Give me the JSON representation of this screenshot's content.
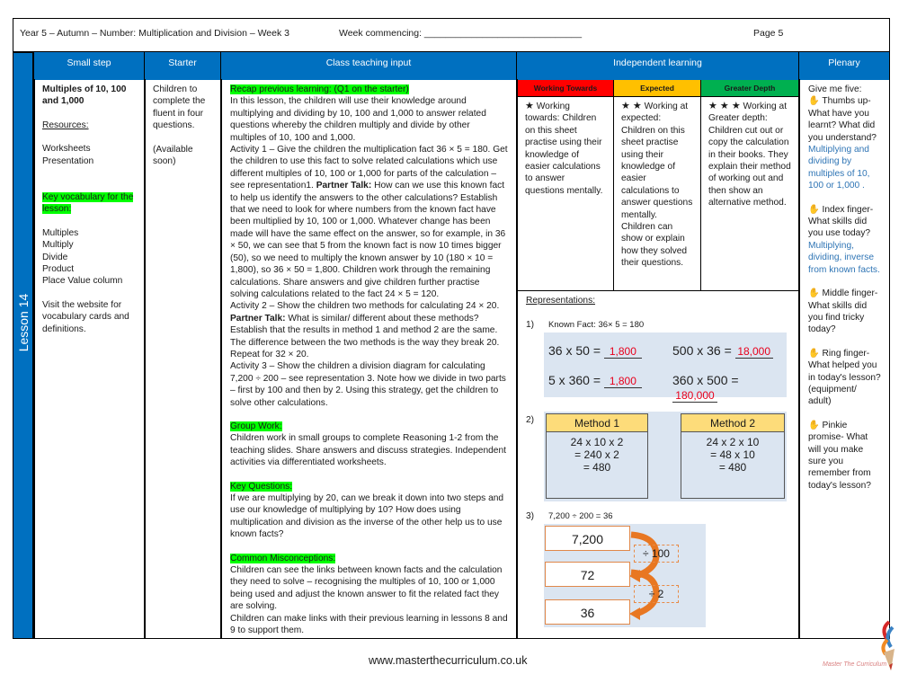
{
  "topbar": {
    "title": "Year 5 – Autumn – Number: Multiplication and Division  – Week 3",
    "week_commencing": "Week commencing: ______________________________",
    "page": "Page 5"
  },
  "colors": {
    "header_blue": "#0070c0",
    "highlight": "#00ff00",
    "working_towards": "#ff0000",
    "expected": "#ffc000",
    "greater_depth": "#00b050",
    "answer_red": "#e8001c",
    "plenary_blue": "#2f75b5"
  },
  "lesson_label": "Lesson 14",
  "headers": {
    "small_step": "Small step",
    "starter": "Starter",
    "class_teaching": "Class teaching input",
    "independent": "Independent learning",
    "plenary": "Plenary"
  },
  "small_step": {
    "title": "Multiples of 10, 100 and 1,000",
    "resources_label": "Resources:",
    "resources": [
      "Worksheets",
      "Presentation"
    ],
    "vocab_label": "Key vocabulary for the lesson:",
    "vocab": [
      "Multiples",
      "Multiply",
      "Divide",
      "Product",
      "Place Value column"
    ],
    "visit_note": "Visit the website for vocabulary cards and definitions."
  },
  "starter": {
    "text": "Children to complete the fluent in four questions.",
    "note": "(Available soon)"
  },
  "class_teaching": {
    "recap": "Recap previous learning: (Q1 on the starter)",
    "para1": "In this lesson, the children will use their knowledge around multiplying and dividing by 10, 100 and 1,000 to answer related questions whereby the children multiply and divide by other multiples of 10, 100 and 1,000.",
    "activity1_a": "Activity 1 – Give the children the multiplication fact 36 × 5 = 180. Get the children to use this fact to solve related calculations which use different multiples of 10, 100 or 1,000 for parts of the calculation – see representation1. ",
    "partner_talk": "Partner Talk:",
    "activity1_b": " How can we use this known fact to help us identify the answers to the other calculations? Establish that we need to look for where numbers from the known fact have been multiplied by 10, 100 or 1,000. Whatever change has been made will have the same effect on the answer, so for example, in 36 × 50, we can see that 5 from the known fact is now 10 times bigger (50), so we need to multiply the known answer by 10 (180 × 10 = 1,800), so 36 × 50 = 1,800. Children work through the remaining calculations. Share answers and give children further practise solving calculations related to the fact 24 × 5 = 120.",
    "activity2": "Activity 2 – Show the children two methods for calculating 24 × 20.",
    "activity2_b": " What is similar/ different about these methods? Establish that the results in method 1 and method 2 are the same. The difference between the two methods is the way they break 20. Repeat for 32 × 20.",
    "activity3": "Activity 3 – Show the children a division diagram for calculating 7,200 ÷ 200 – see representation 3. Note how we divide in two parts – first by 100 and then by 2. Using this strategy, get the children to solve other calculations.",
    "group_work_label": "Group Work:",
    "group_work": "Children work in small groups to complete Reasoning 1-2 from the teaching slides. Share answers and discuss strategies. Independent activities via differentiated worksheets.",
    "key_questions_label": "Key Questions:",
    "key_questions": "If we are multiplying by 20, can we break it down into two steps and use our knowledge of multiplying by 10? How does using multiplication and division as the inverse of the other help us to use known facts?",
    "misconceptions_label": "Common Misconceptions:",
    "misconceptions_1": "Children can see the links between known facts and the calculation they need to solve – recognising the multiples of 10, 100 or 1,000 being used and adjust the known answer to fit the related fact they are solving.",
    "misconceptions_2": "Children can make links with their previous learning in lessons 8 and 9 to support them."
  },
  "independent": {
    "levels": [
      {
        "label": "Working Towards",
        "stars": "★",
        "text": "Working towards: Children on this sheet practise using their knowledge of easier calculations to answer questions mentally."
      },
      {
        "label": "Expected",
        "stars": "★ ★",
        "text": "Working at expected: Children on this sheet practise using their knowledge of easier calculations to answer questions mentally. Children can show or explain how they solved their questions."
      },
      {
        "label": "Greater Depth",
        "stars": "★ ★ ★",
        "text": "Working at Greater depth: Children cut out or copy the calculation in their books. They explain their method of working out and then show an alternative method."
      }
    ],
    "representations_label": "Representations:",
    "rep1": {
      "num": "1)",
      "known_fact": "Known Fact: 36× 5 = 180",
      "equations": [
        {
          "q": "36 x 50 =",
          "a": "1,800"
        },
        {
          "q": "500 x 36 =",
          "a": "18,000"
        },
        {
          "q": "5 x 360 =",
          "a": "1,800"
        },
        {
          "q": "360 x 500 =",
          "a": "180,000"
        }
      ]
    },
    "rep2": {
      "num": "2)",
      "methods": [
        {
          "title": "Method 1",
          "lines": [
            "24 x 10 x 2",
            "= 240 x 2",
            "= 480"
          ]
        },
        {
          "title": "Method 2",
          "lines": [
            "24 x 2 x 10",
            "= 48 x 10",
            "= 480"
          ]
        }
      ]
    },
    "rep3": {
      "num": "3)",
      "equation": "7,200 ÷ 200 = 36",
      "values": [
        "7,200",
        "72",
        "36"
      ],
      "steps": [
        "÷ 100",
        "÷ 2"
      ]
    }
  },
  "plenary": {
    "intro": "Give me five:",
    "hand_icon": "✋",
    "thumb": "Thumbs up- What have you learnt? What did you understand?",
    "thumb_answer": "Multiplying and dividing by multiples of 10, 100 or 1,000 .",
    "index": "Index finger- What skills did you use today?",
    "index_answer": "Multiplying, dividing, inverse from known facts.",
    "middle": "Middle finger- What skills did you find tricky today?",
    "ring": "Ring finger- What helped you in today's lesson? (equipment/ adult)",
    "pinkie": "Pinkie promise- What will you make sure you remember from today's lesson?"
  },
  "footer": {
    "url": "www.masterthecurriculum.co.uk",
    "logo_text": "Master The Curriculum"
  }
}
